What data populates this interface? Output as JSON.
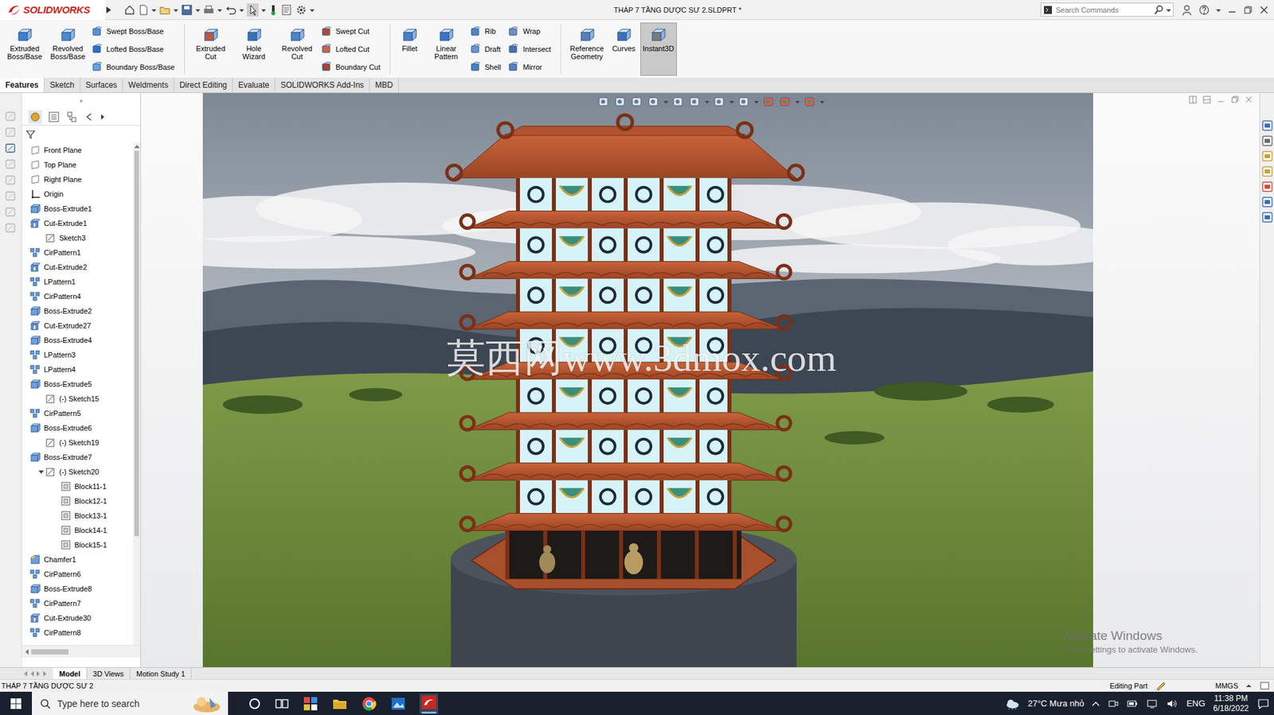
{
  "window": {
    "title": "THÁP 7 TẦNG DƯỢC SƯ 2.SLDPRT *"
  },
  "app": {
    "logo": "SOLIDWORKS"
  },
  "search": {
    "placeholder": "Search Commands"
  },
  "command_groups": [
    [
      {
        "label": "Extruded Boss/Base",
        "kind": "large",
        "selected": false
      },
      {
        "label": "Revolved Boss/Base",
        "kind": "large",
        "selected": false
      },
      {
        "label": "Swept Boss/Base",
        "kind": "small",
        "selected": false
      },
      {
        "label": "Lofted Boss/Base",
        "kind": "small",
        "selected": false
      },
      {
        "label": "Boundary Boss/Base",
        "kind": "small",
        "selected": false
      }
    ],
    [
      {
        "label": "Extruded Cut",
        "kind": "large",
        "selected": false
      },
      {
        "label": "Hole Wizard",
        "kind": "large",
        "selected": false
      },
      {
        "label": "Revolved Cut",
        "kind": "large",
        "selected": false
      },
      {
        "label": "Swept Cut",
        "kind": "small",
        "selected": false
      },
      {
        "label": "Lofted Cut",
        "kind": "small",
        "selected": false
      },
      {
        "label": "Boundary Cut",
        "kind": "small",
        "selected": false
      }
    ],
    [
      {
        "label": "Fillet",
        "kind": "large",
        "selected": false
      },
      {
        "label": "Linear Pattern",
        "kind": "large",
        "selected": false
      },
      {
        "label": "Rib",
        "kind": "small",
        "selected": false
      },
      {
        "label": "Draft",
        "kind": "small",
        "selected": false
      },
      {
        "label": "Shell",
        "kind": "small",
        "selected": false
      },
      {
        "label": "Wrap",
        "kind": "small",
        "selected": false
      },
      {
        "label": "Intersect",
        "kind": "small",
        "selected": false
      },
      {
        "label": "Mirror",
        "kind": "small",
        "selected": false
      }
    ],
    [
      {
        "label": "Reference Geometry",
        "kind": "large",
        "selected": false
      },
      {
        "label": "Curves",
        "kind": "large",
        "selected": false
      },
      {
        "label": "Instant3D",
        "kind": "large",
        "selected": true
      }
    ]
  ],
  "tabs": [
    {
      "label": "Features",
      "selected": true
    },
    {
      "label": "Sketch",
      "selected": false
    },
    {
      "label": "Surfaces",
      "selected": false
    },
    {
      "label": "Weldments",
      "selected": false
    },
    {
      "label": "Direct Editing",
      "selected": false
    },
    {
      "label": "Evaluate",
      "selected": false
    },
    {
      "label": "SOLIDWORKS Add-Ins",
      "selected": false
    },
    {
      "label": "MBD",
      "selected": false
    }
  ],
  "tree": {
    "items": [
      {
        "label": "Front Plane",
        "kind": "plane",
        "depth": 0
      },
      {
        "label": "Top Plane",
        "kind": "plane",
        "depth": 0
      },
      {
        "label": "Right Plane",
        "kind": "plane",
        "depth": 0
      },
      {
        "label": "Origin",
        "kind": "origin",
        "depth": 0
      },
      {
        "label": "Boss-Extrude1",
        "kind": "boss",
        "depth": 0
      },
      {
        "label": "Cut-Extrude1",
        "kind": "cut",
        "depth": 0
      },
      {
        "label": "Sketch3",
        "kind": "sketch",
        "depth": 1
      },
      {
        "label": "CirPattern1",
        "kind": "pattern",
        "depth": 0
      },
      {
        "label": "Cut-Extrude2",
        "kind": "cut",
        "depth": 0
      },
      {
        "label": "LPattern1",
        "kind": "pattern",
        "depth": 0
      },
      {
        "label": "CirPattern4",
        "kind": "pattern",
        "depth": 0
      },
      {
        "label": "Boss-Extrude2",
        "kind": "boss",
        "depth": 0
      },
      {
        "label": "Cut-Extrude27",
        "kind": "cut",
        "depth": 0
      },
      {
        "label": "Boss-Extrude4",
        "kind": "boss",
        "depth": 0
      },
      {
        "label": "LPattern3",
        "kind": "pattern",
        "depth": 0
      },
      {
        "label": "LPattern4",
        "kind": "pattern",
        "depth": 0
      },
      {
        "label": "Boss-Extrude5",
        "kind": "boss",
        "depth": 0
      },
      {
        "label": "(-) Sketch15",
        "kind": "sketch",
        "depth": 1
      },
      {
        "label": "CirPattern5",
        "kind": "pattern",
        "depth": 0
      },
      {
        "label": "Boss-Extrude6",
        "kind": "boss",
        "depth": 0
      },
      {
        "label": "(-) Sketch19",
        "kind": "sketch",
        "depth": 1
      },
      {
        "label": "Boss-Extrude7",
        "kind": "boss",
        "depth": 0
      },
      {
        "label": "(-) Sketch20",
        "kind": "sketch",
        "depth": 1,
        "expanded": true
      },
      {
        "label": "Block11-1",
        "kind": "block",
        "depth": 2
      },
      {
        "label": "Block12-1",
        "kind": "block",
        "depth": 2
      },
      {
        "label": "Block13-1",
        "kind": "block",
        "depth": 2
      },
      {
        "label": "Block14-1",
        "kind": "block",
        "depth": 2
      },
      {
        "label": "Block15-1",
        "kind": "block",
        "depth": 2
      },
      {
        "label": "Chamfer1",
        "kind": "chamfer",
        "depth": 0
      },
      {
        "label": "CirPattern6",
        "kind": "pattern",
        "depth": 0
      },
      {
        "label": "Boss-Extrude8",
        "kind": "boss",
        "depth": 0
      },
      {
        "label": "CirPattern7",
        "kind": "pattern",
        "depth": 0
      },
      {
        "label": "Cut-Extrude30",
        "kind": "cut",
        "depth": 0
      },
      {
        "label": "CirPattern8",
        "kind": "pattern",
        "depth": 0
      }
    ]
  },
  "watermark": {
    "text": "莫西网www.3dmox.com"
  },
  "activation": {
    "title": "Activate Windows",
    "subtitle": "Go to settings to activate Windows."
  },
  "bottom_tabs": [
    {
      "label": "Model",
      "selected": true
    },
    {
      "label": "3D Views",
      "selected": false
    },
    {
      "label": "Motion Study 1",
      "selected": false
    }
  ],
  "status_bar": {
    "document": "THÁP 7 TẦNG DƯỢC SƯ 2",
    "mode": "Editing Part",
    "units": "MMGS"
  },
  "taskbar": {
    "search": "Type here to search",
    "weather": "27°C Mưa nhỏ",
    "language": "ENG",
    "time": "11:38 PM",
    "date": "6/18/2022"
  }
}
